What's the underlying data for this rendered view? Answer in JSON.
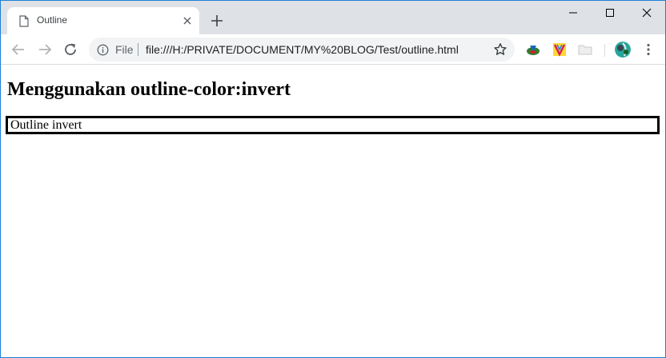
{
  "tab": {
    "title": "Outline"
  },
  "omnibox": {
    "scheme_label": "File",
    "url": "file:///H:/PRIVATE/DOCUMENT/MY%20BLOG/Test/outline.html"
  },
  "page": {
    "heading": "Menggunakan outline-color:invert",
    "outline_box_text": "Outline invert"
  },
  "colors": {
    "window_border": "#1c7fd6",
    "tabstrip_bg": "#dee1e6",
    "omnibox_bg": "#f1f3f4",
    "outline_color": "#000000"
  },
  "icons": {
    "tab_favicon": "document-icon",
    "tab_close": "close-icon",
    "new_tab": "plus-icon",
    "back": "back-arrow-icon",
    "forward": "forward-arrow-icon",
    "reload": "reload-icon",
    "info": "info-icon",
    "bookmark": "star-icon",
    "menu": "kebab-menu-icon"
  }
}
